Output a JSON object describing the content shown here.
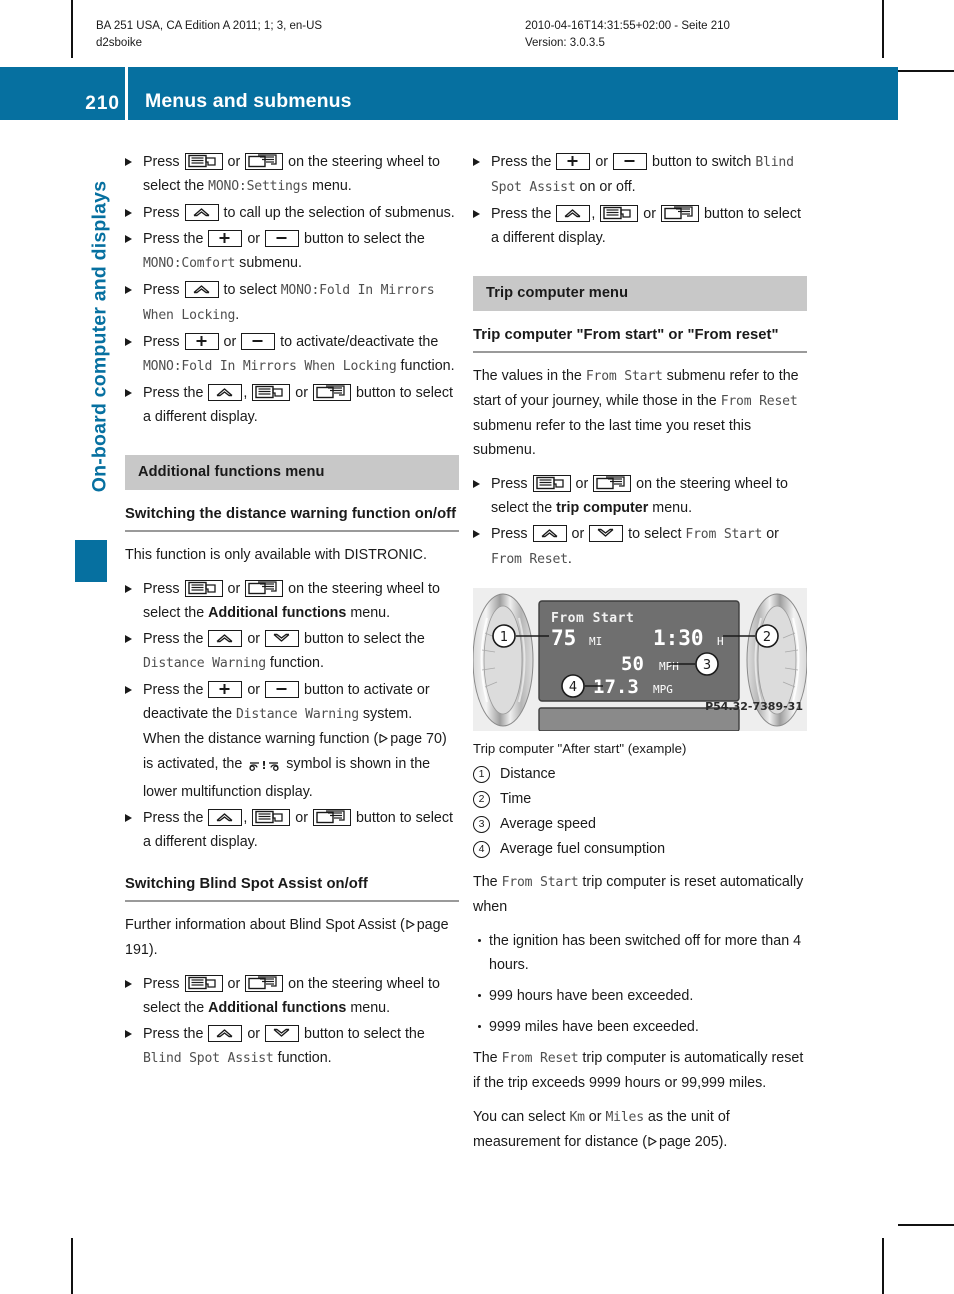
{
  "print_meta": {
    "left": "BA 251 USA, CA Edition A 2011; 1; 3, en-US\nd2sboike",
    "right": "2010-04-16T14:31:55+02:00 - Seite 210\nVersion: 3.0.3.5"
  },
  "header": {
    "page_number": "210",
    "title": "Menus and submenus",
    "accent_color": "#0670a0"
  },
  "chapter_tab": {
    "label": "On-board computer and displays",
    "color": "#0670a0"
  },
  "left_column": {
    "steps_top": [
      {
        "parts": [
          "Press ",
          "KEY_LEFT_PANEL",
          " or ",
          "KEY_RIGHT_PANEL",
          " on the steering wheel to select the ",
          "MONO:Settings",
          " menu."
        ]
      },
      {
        "parts": [
          "Press ",
          "KEY_UP",
          " to call up the selection of submenus."
        ]
      },
      {
        "parts": [
          "Press the ",
          "KEY_PLUS",
          " or ",
          "KEY_MINUS",
          " button to select the ",
          "MONO:Comfort",
          " submenu."
        ]
      },
      {
        "parts": [
          "Press ",
          "KEY_UP",
          " to select ",
          "MONO:Fold In Mirrors When Locking",
          "."
        ]
      },
      {
        "parts": [
          "Press ",
          "KEY_PLUS",
          " or ",
          "KEY_MINUS",
          " to activate/deactivate the ",
          "MONO:Fold In Mirrors When Locking",
          " function."
        ]
      },
      {
        "parts": [
          "Press the ",
          "KEY_UP",
          ", ",
          "KEY_LEFT_PANEL",
          " or ",
          "KEY_RIGHT_PANEL",
          " button to select a different display."
        ]
      }
    ],
    "section_banner": "Additional functions menu",
    "subhead_distance": "Switching the distance warning function on/off",
    "distance_intro": "This function is only available with DISTRONIC.",
    "distance_steps": [
      {
        "text_a": "Press ",
        "text_b": " or ",
        "text_c": " on the steering wheel to select the ",
        "bold": "Additional functions",
        "text_d": " menu."
      },
      {
        "text_a": "Press the ",
        "text_b": " or ",
        "text_c": " button to select the ",
        "mono": "Distance Warning",
        "text_d": " function."
      }
    ],
    "distance_step3_a": "Press the ",
    "distance_step3_b": " or ",
    "distance_step3_c": " button to activate or deactivate the ",
    "distance_step3_mono": "Distance Warning",
    "distance_step3_d": " system.",
    "distance_note_a": "When the distance warning function (",
    "distance_note_page": "page 70",
    "distance_note_b": ") is activated, the ",
    "distance_note_c": " symbol is shown in the lower multifunction display.",
    "distance_step4_a": "Press the ",
    "distance_step4_b": ", ",
    "distance_step4_c": " or ",
    "distance_step4_d": " button to select a different display.",
    "subhead_blindspot": "Switching Blind Spot Assist on/off",
    "blindspot_intro_a": "Further information about Blind Spot Assist (",
    "blindspot_intro_page": "page 191",
    "blindspot_intro_b": ").",
    "blindspot_step1_a": "Press ",
    "blindspot_step1_b": " or ",
    "blindspot_step1_c": " on the steering wheel to select the ",
    "blindspot_step1_bold": "Additional functions",
    "blindspot_step1_d": " menu.",
    "blindspot_step2_a": "Press the ",
    "blindspot_step2_b": " or ",
    "blindspot_step2_c": " button to select the ",
    "blindspot_step2_mono": "Blind Spot Assist",
    "blindspot_step2_d": " function."
  },
  "right_column": {
    "bs_step3_a": "Press the ",
    "bs_step3_b": " or ",
    "bs_step3_c": " button to switch ",
    "bs_step3_mono": "Blind Spot Assist",
    "bs_step3_d": " on or off.",
    "bs_step4_a": "Press the ",
    "bs_step4_b": ", ",
    "bs_step4_c": " or ",
    "bs_step4_d": " button to select a different display.",
    "section_banner": "Trip computer menu",
    "subhead": "Trip computer \"From start\" or \"From reset\"",
    "intro_a": "The values in the ",
    "intro_mono1": "From Start",
    "intro_b": " submenu refer to the start of your journey, while those in the ",
    "intro_mono2": "From Reset",
    "intro_c": " submenu refer to the last time you reset this submenu.",
    "step1_a": "Press ",
    "step1_b": " or ",
    "step1_c": " on the steering wheel to select the ",
    "step1_bold": "trip computer",
    "step1_d": " menu.",
    "step2_a": "Press ",
    "step2_b": " or ",
    "step2_c": " to select ",
    "step2_mono1": "From Start",
    "step2_d": " or ",
    "step2_mono2": "From Reset",
    "step2_e": ".",
    "figure": {
      "display_title": "From Start",
      "distance_value": "75",
      "distance_unit": "MI",
      "time_value": "1:30",
      "time_unit": "H",
      "speed_value": "50",
      "speed_unit": "MPH",
      "consumption_value": "17.3",
      "consumption_unit": "MPG",
      "image_code": "P54.32-7389-31",
      "callouts": [
        "1",
        "2",
        "3",
        "4"
      ]
    },
    "fig_caption": "Trip computer \"After start\" (example)",
    "legend": [
      {
        "num": "1",
        "label": "Distance"
      },
      {
        "num": "2",
        "label": "Time"
      },
      {
        "num": "3",
        "label": "Average speed"
      },
      {
        "num": "4",
        "label": "Average fuel consumption"
      }
    ],
    "reset_intro_a": "The ",
    "reset_intro_mono": "From Start",
    "reset_intro_b": " trip computer is reset automatically when",
    "reset_bullets": [
      "the ignition has been switched off for more than 4 hours.",
      "999 hours have been exceeded.",
      "9999 miles have been exceeded."
    ],
    "reset2_a": "The ",
    "reset2_mono": "From Reset",
    "reset2_b": " trip computer is automatically reset if the trip exceeds 9999 hours or 99,999 miles.",
    "units_a": "You can select ",
    "units_mono1": "Km",
    "units_b": " or ",
    "units_mono2": "Miles",
    "units_c": " as the unit of measurement for distance (",
    "units_page": "page 205",
    "units_d": ")."
  }
}
